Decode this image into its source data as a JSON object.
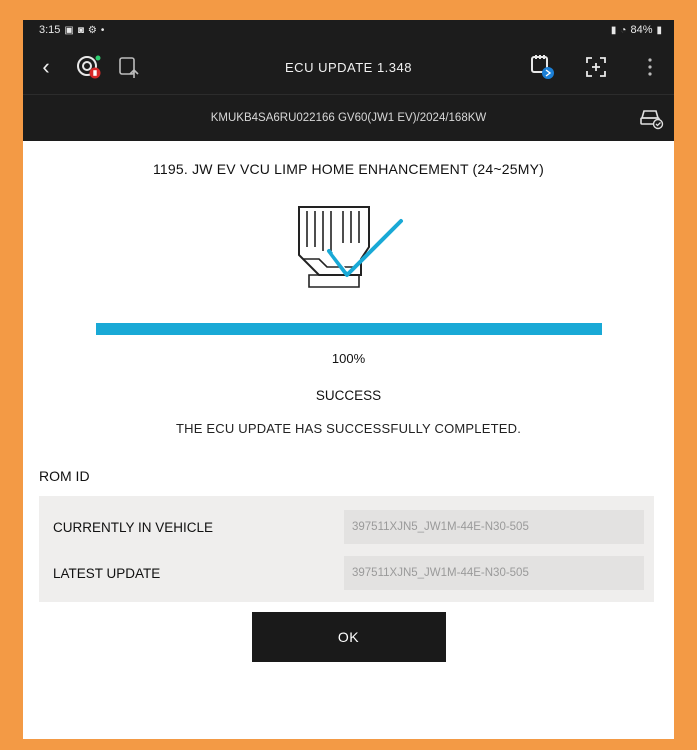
{
  "status_bar": {
    "time": "3:15",
    "battery": "84%",
    "signal_text": "◂ıl"
  },
  "app_bar": {
    "back_icon": "back-arrow-icon",
    "title": "ECU UPDATE 1.348"
  },
  "vehicle": {
    "info": "KMUKB4SA6RU022166 GV60(JW1 EV)/2024/168KW"
  },
  "job": {
    "title": "1195. JW EV VCU LIMP HOME ENHANCEMENT (24~25MY)"
  },
  "progress": {
    "value": 1.0,
    "label": "100%"
  },
  "result": {
    "status": "SUCCESS",
    "message": "THE ECU UPDATE HAS SUCCESSFULLY COMPLETED."
  },
  "rom": {
    "heading": "ROM ID",
    "rows": [
      {
        "label": "CURRENTLY IN VEHICLE",
        "value": "397511XJN5_JW1M-44E-N30-505"
      },
      {
        "label": "LATEST UPDATE",
        "value": "397511XJN5_JW1M-44E-N30-505"
      }
    ]
  },
  "actions": {
    "ok_label": "OK"
  },
  "colors": {
    "border": "#f39a45",
    "header_bg": "#1c1c1c",
    "progress_fill": "#19a9d6",
    "check": "#19a9d6"
  }
}
